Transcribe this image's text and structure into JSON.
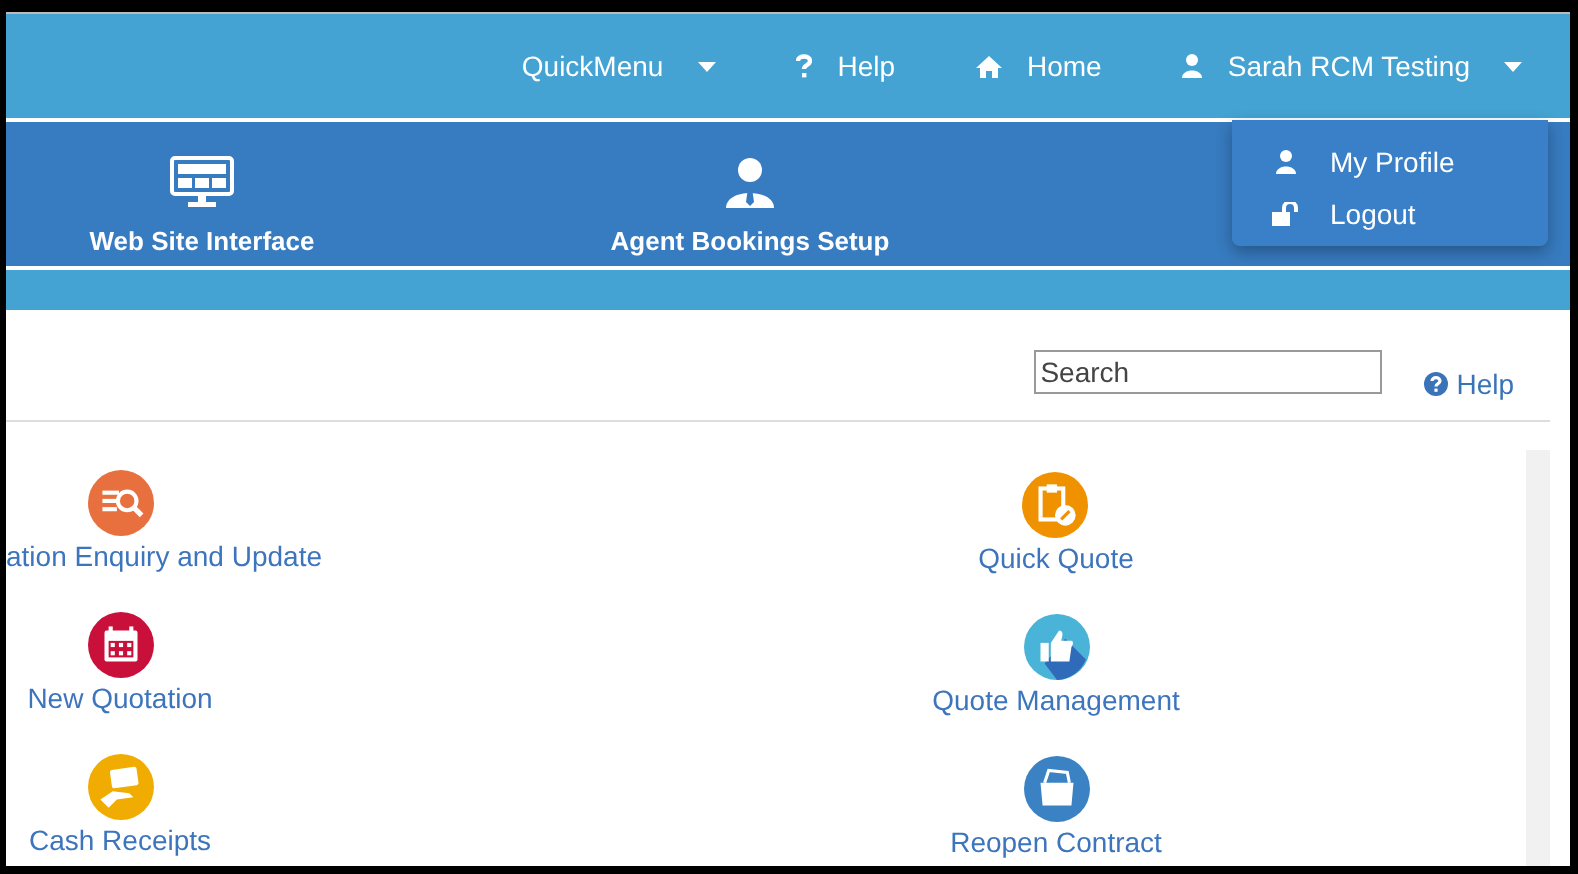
{
  "top_bar": {
    "items": [
      {
        "kind": "menu",
        "label": "QuickMenu"
      },
      {
        "kind": "help",
        "label": "Help"
      },
      {
        "kind": "home",
        "label": "Home"
      },
      {
        "kind": "user",
        "label": "Sarah RCM Testing",
        "expanded": true
      }
    ]
  },
  "user_menu": {
    "items": [
      {
        "kind": "user",
        "label": "My Profile"
      },
      {
        "kind": "lock",
        "label": "Logout"
      }
    ]
  },
  "nav": {
    "items": [
      {
        "kind": "monitor",
        "label": "Web Site Interface"
      },
      {
        "kind": "agent",
        "label": "Agent Bookings Setup"
      }
    ]
  },
  "toolbar": {
    "search": {
      "placeholder": "Search"
    },
    "help": "Help"
  },
  "tiles": [
    [
      {
        "kind": "search-list",
        "color": "#e8703f",
        "label": "ation Enquiry and Update"
      },
      {
        "kind": "calendar",
        "color": "#c8103a",
        "label": "New Quotation"
      },
      {
        "kind": "cash",
        "color": "#f0ac00",
        "label": "Cash Receipts"
      }
    ],
    [
      {
        "kind": "clipboard",
        "color": "#f09200",
        "label": "Quick Quote"
      },
      {
        "kind": "thumb",
        "color": "#4ab3d8",
        "label": "Quote Management"
      },
      {
        "kind": "folder",
        "color": "#3a82c4",
        "label": "Reopen Contract"
      }
    ]
  ]
}
